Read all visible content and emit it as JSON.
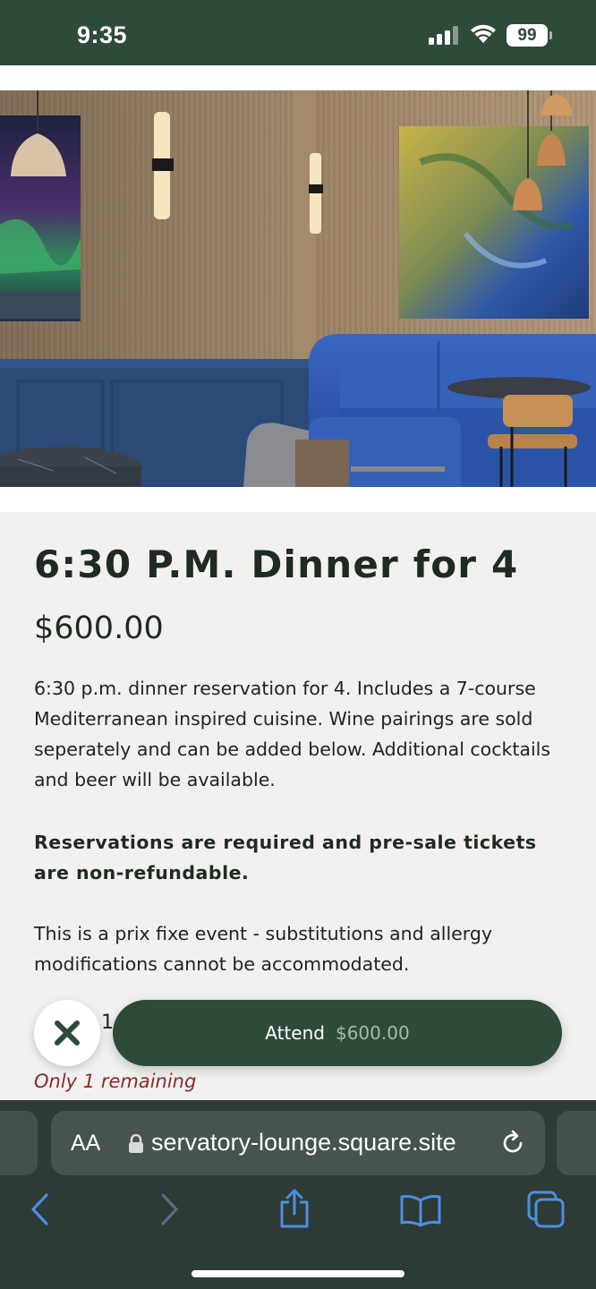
{
  "status_bar": {
    "time": "9:35",
    "battery": "99",
    "icons": [
      "signal-icon",
      "wifi-icon",
      "battery-icon"
    ]
  },
  "hero": {
    "icon": "restaurant-interior-photo"
  },
  "event": {
    "title": "6:30 P.M. Dinner for 4",
    "price": "$600.00",
    "description": "6:30 p.m. dinner reservation for 4. Includes a 7-course Mediterranean inspired cuisine. Wine pairings are sold seperately and can be added below. Additional cocktails and beer will be available.",
    "notice": "Reservations are required and pre-sale tickets are non-refundable.",
    "policy": "This is a prix fixe event - substitutions and allergy modifications cannot be accommodated."
  },
  "purchase": {
    "quantity": "1",
    "attend_label": "Attend",
    "attend_price": "$600.00",
    "remaining": "Only 1 remaining"
  },
  "browser": {
    "text_size_label": "AA",
    "url": "servatory-lounge.square.site",
    "toolbar": [
      "back-icon",
      "forward-icon",
      "share-icon",
      "bookmarks-icon",
      "tabs-icon"
    ]
  },
  "colors": {
    "brand_green": "#2e4a38",
    "remaining_red": "#8a2b2b",
    "safari_link_blue": "#4a90e2"
  }
}
